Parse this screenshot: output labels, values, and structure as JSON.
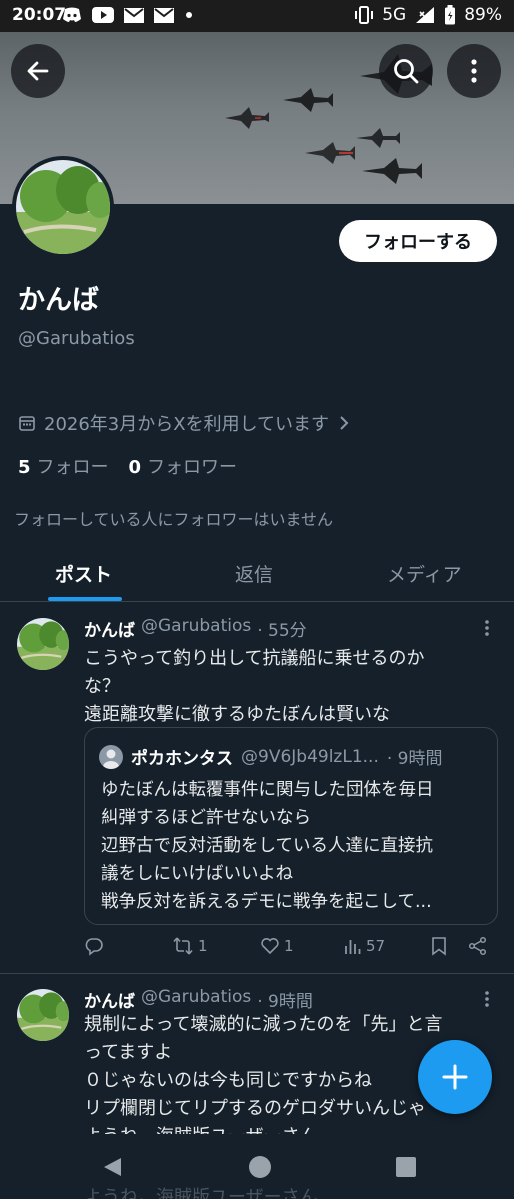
{
  "status_bar": {
    "time": "20:07",
    "network": "5G",
    "battery": "89%",
    "notification_icons": [
      "discord-icon",
      "youtube-icon",
      "mail-icon",
      "mail-icon",
      "dot-icon"
    ]
  },
  "profile": {
    "display_name": "かんば",
    "handle": "@Garubatios",
    "joined": "2026年3月からXを利用しています",
    "following_count": "5",
    "following_label": "フォロー",
    "followers_count": "0",
    "followers_label": "フォロワー",
    "no_common_followers": "フォローしている人にフォロワーはいません",
    "follow_button": "フォローする"
  },
  "tabs": [
    {
      "label": "ポスト",
      "active": true
    },
    {
      "label": "返信",
      "active": false
    },
    {
      "label": "メディア",
      "active": false
    }
  ],
  "posts": [
    {
      "name": "かんば",
      "handle": "@Garubatios",
      "time": "· 55分",
      "lines": [
        "こうやって釣り出して抗議船に乗せるのか",
        "な？",
        "遠距離攻撃に徹するゆたぼんは賢いな"
      ],
      "quote": {
        "name": "ポカホンタス",
        "handle": "@9V6Jb49lzL1...",
        "time": "· 9時間",
        "lines": [
          "ゆたぼんは転覆事件に関与した団体を毎日",
          "糾弾するほど許せないなら",
          "辺野古で反対活動をしている人達に直接抗",
          "議をしにいけばいいよね",
          "戦争反対を訴えるデモに戦争を起こして..."
        ]
      },
      "actions": {
        "retweets": "1",
        "likes": "1",
        "views": "57"
      }
    },
    {
      "name": "かんば",
      "handle": "@Garubatios",
      "time": "· 9時間",
      "lines": [
        "規制によって壊滅的に減ったのを「先」と言",
        "ってますよ",
        "０じゃないのは今も同じですからね",
        "リプ欄閉じてリプするのゲロダサいんじゃ",
        "ようね。海賊版ユーザーさん"
      ]
    }
  ],
  "nav_overlay_text": "ようね。海賊版ユーザーさん",
  "colors": {
    "background": "#15202b",
    "accent": "#1d9bf0",
    "muted": "#8b98a5",
    "divider": "#38444d"
  }
}
